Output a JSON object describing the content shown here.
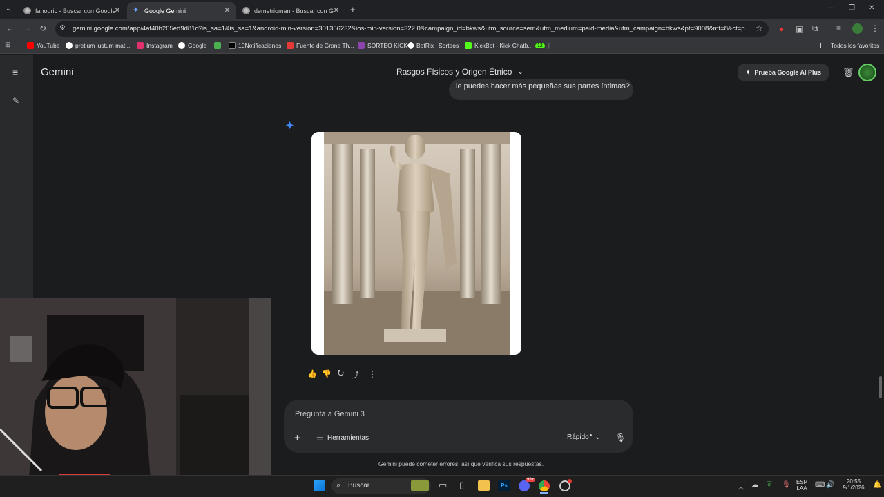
{
  "browser": {
    "tabs": [
      {
        "title": "fanodric - Buscar con Google",
        "active": false
      },
      {
        "title": "Google Gemini",
        "active": true
      },
      {
        "title": "demetrioman - Buscar con Goo",
        "active": false
      }
    ],
    "url": "gemini.google.com/app/4af40b205ed9d81d?is_sa=1&is_sa=1&android-min-version=301356232&ios-min-version=322.0&campaign_id=bkws&utm_source=sem&utm_medium=paid-media&utm_campaign=bkws&pt=9008&mt=8&ct=p...",
    "bookmarks": [
      {
        "label": "YouTube",
        "color": "#ff0000"
      },
      {
        "label": "pretium iustum mat...",
        "color": "#ffffff"
      },
      {
        "label": "Instagram",
        "color": "#e1306c"
      },
      {
        "label": "Google",
        "color": "#ffffff"
      },
      {
        "label": "",
        "color": "#4caf50"
      },
      {
        "label": "10Notificaciones",
        "color": "#000000"
      },
      {
        "label": "Fuente de Grand Th...",
        "color": "#e53935"
      },
      {
        "label": "SORTEO KICK",
        "color": "#8e44ad"
      },
      {
        "label": "BotRix | Sorteos",
        "color": "#ffffff"
      },
      {
        "label": "KickBot - Kick Chatb...",
        "color": "#53fc18"
      },
      {
        "label": "12",
        "color": "#53fc18"
      }
    ],
    "all_bookmarks_label": "Todos los favoritos"
  },
  "gemini": {
    "app_title": "Gemini",
    "chat_title": "Rasgos Físicos y Origen Étnico",
    "upgrade_button": "Prueba Google AI Plus",
    "user_message": "le puedes hacer más pequeñas sus partes íntimas?",
    "composer_placeholder": "Pregunta a Gemini 3",
    "tools_label": "Herramientas",
    "mode_label": "Rápido",
    "disclaimer": "Gemini puede cometer errores, así que verifica sus respuestas.",
    "accent_color": "#4285f4"
  },
  "taskbar": {
    "search_label": "Buscar",
    "language": "ESP",
    "language_sub": "LAA",
    "time": "20:55",
    "date": "9/1/2026",
    "discord_badge": "99+"
  }
}
